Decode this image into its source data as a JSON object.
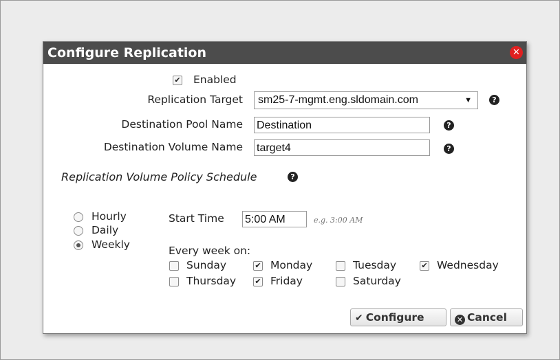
{
  "dialog": {
    "title": "Configure Replication",
    "close_icon": "close-icon"
  },
  "form": {
    "enabled": {
      "label": "Enabled",
      "checked": true
    },
    "replication_target": {
      "label": "Replication Target",
      "value": "sm25-7-mgmt.eng.sldomain.com",
      "help_icon": "help-icon"
    },
    "destination_pool": {
      "label": "Destination Pool Name",
      "value": "Destination",
      "help_icon": "help-icon"
    },
    "destination_volume": {
      "label": "Destination Volume Name",
      "value": "target4",
      "help_icon": "help-icon"
    }
  },
  "schedule": {
    "title": "Replication Volume Policy Schedule",
    "frequency": [
      {
        "label": "Hourly",
        "selected": false
      },
      {
        "label": "Daily",
        "selected": false
      },
      {
        "label": "Weekly",
        "selected": true
      }
    ],
    "start_time": {
      "label": "Start Time",
      "value": "5:00 AM",
      "hint": "e.g. 3:00 AM"
    },
    "every_week_label": "Every week on:",
    "days": [
      {
        "label": "Sunday",
        "checked": false
      },
      {
        "label": "Monday",
        "checked": true
      },
      {
        "label": "Tuesday",
        "checked": false
      },
      {
        "label": "Wednesday",
        "checked": true
      },
      {
        "label": "Thursday",
        "checked": false
      },
      {
        "label": "Friday",
        "checked": true
      },
      {
        "label": "Saturday",
        "checked": false
      }
    ]
  },
  "buttons": {
    "configure": "Configure",
    "cancel": "Cancel"
  }
}
